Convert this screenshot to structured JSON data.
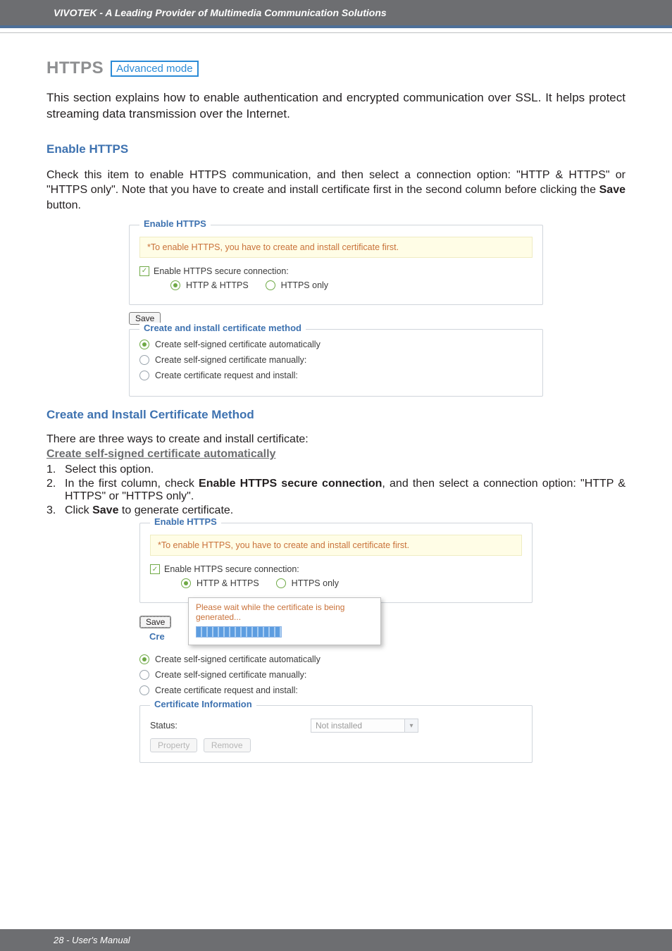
{
  "header": {
    "title": "VIVOTEK - A Leading Provider of Multimedia Communication Solutions"
  },
  "footer": {
    "page_label": "28 - User's Manual"
  },
  "title": {
    "heading": "HTTPS",
    "mode_tag": "Advanced mode"
  },
  "intro": "This section explains how to enable authentication and encrypted communication over SSL. It helps protect streaming data transmission over the Internet.",
  "enable_section": {
    "heading": "Enable HTTPS",
    "text_pre": "Check this item to enable HTTPS communication, and then select a connection option: \"HTTP & HTTPS\" or \"HTTPS only\". Note that you have to create and install certificate first in the second column before clicking the ",
    "text_bold": "Save",
    "text_post": " button."
  },
  "panel1": {
    "legend": "Enable HTTPS",
    "notice": "*To enable HTTPS, you have to create and install certificate first.",
    "checkbox_label": "Enable HTTPS secure connection:",
    "opt_a": "HTTP & HTTPS",
    "opt_b": "HTTPS only",
    "save_label": "Save",
    "method_legend": "Create and install certificate method",
    "m1": "Create self-signed certificate automatically",
    "m2": "Create self-signed certificate manually:",
    "m3": "Create certificate request and install:"
  },
  "method_section": {
    "heading": "Create and Install Certificate Method",
    "lead": "There are three ways to create and install certificate:",
    "sub": "Create self-signed certificate automatically",
    "step1": "Select this option.",
    "step2_pre": "In the first column, check ",
    "step2_bold": "Enable HTTPS secure connection",
    "step2_mid": ", and then select a connection option: \"HTTP & HTTPS\" or \"HTTPS only\".",
    "step3_pre": "Click ",
    "step3_bold": "Save",
    "step3_post": " to generate certificate."
  },
  "panel2": {
    "legend": "Enable HTTPS",
    "notice": "*To enable HTTPS, you have to create and install certificate first.",
    "checkbox_label": "Enable HTTPS secure connection:",
    "opt_a": "HTTP & HTTPS",
    "opt_b": "HTTPS only",
    "save_label": "Save",
    "popup_line1": "Please wait while the certificate is being generated...",
    "partial_label": "Cre",
    "m1": "Create self-signed certificate automatically",
    "m2": "Create self-signed certificate manually:",
    "m3": "Create certificate request and install:",
    "cert_legend": "Certificate Information",
    "status_label": "Status:",
    "status_value": "Not installed",
    "btn_property": "Property",
    "btn_remove": "Remove"
  }
}
